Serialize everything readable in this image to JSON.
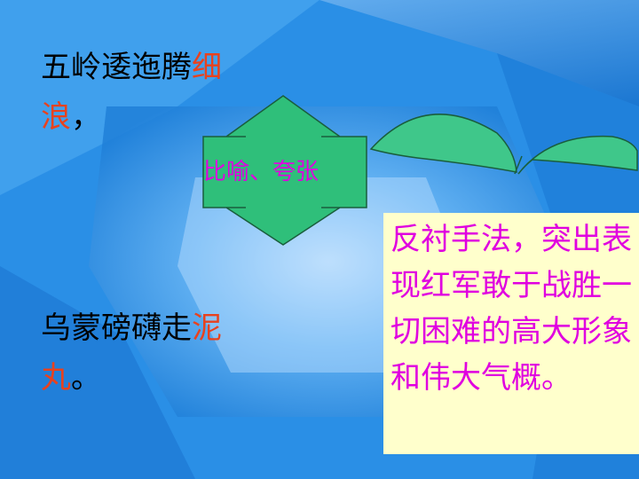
{
  "slide": {
    "verse1": {
      "text": "五岭逶迤腾",
      "highlight": "细浪",
      "punct": "，"
    },
    "verse2": {
      "text": "乌蒙磅礴走",
      "highlight": "泥丸",
      "punct": "。"
    },
    "arrow_label": "比喻、夸张",
    "note": "反衬手法，突出表现红军敢于战胜一切困难的高大形象和伟大气概。",
    "colors": {
      "background": "#2a8fe6",
      "highlight": "#e8421e",
      "label": "#e000e0",
      "arrow_fill": "#2fbf7a",
      "leaf_fill": "#3fc78a",
      "note_bg": "#ffffcc"
    }
  }
}
